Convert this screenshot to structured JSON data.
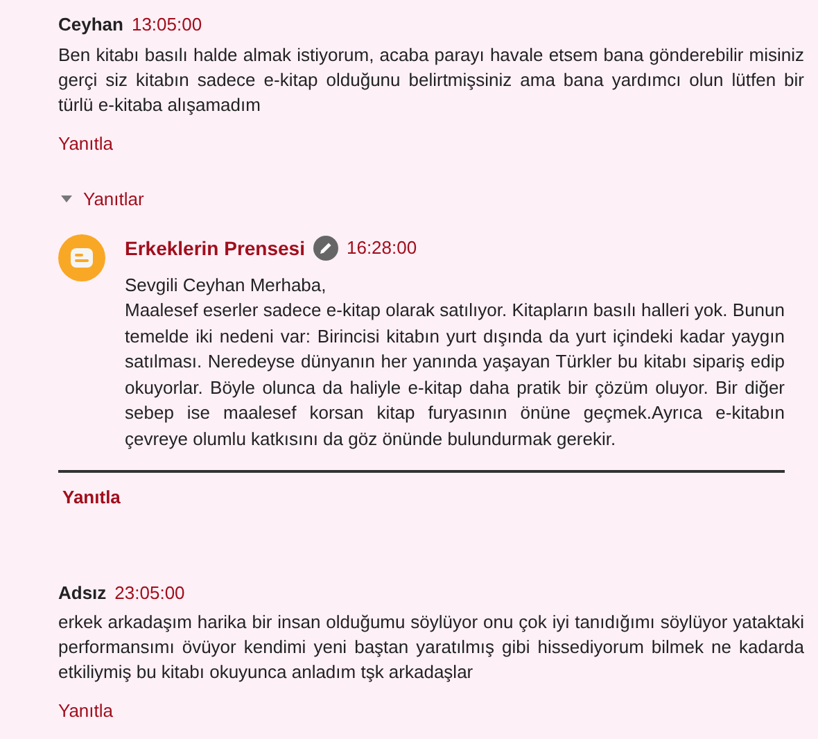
{
  "comments": [
    {
      "author": "Ceyhan",
      "author_is_owner": false,
      "time": "13:05:00",
      "body": "Ben kitabı basılı halde almak istiyorum, acaba parayı havale etsem bana gönderebilir misiniz gerçi siz kitabın sadece e-kitap olduğunu belirtmişsiniz ama bana yardımcı olun lütfen bir türlü e-kitaba alışamadım",
      "reply_link": "Yanıtla",
      "replies_toggle": {
        "label": "Yanıtlar",
        "expanded": true
      },
      "replies": [
        {
          "author": "Erkeklerin Prensesi",
          "author_is_owner": true,
          "time": "16:28:00",
          "body": "Sevgili Ceyhan Merhaba,\nMaalesef eserler sadece e-kitap olarak satılıyor. Kitapların basılı halleri yok. Bunun temelde iki nedeni var: Birincisi kitabın yurt dışında da yurt içindeki kadar yaygın satılması. Neredeyse dünyanın her yanında yaşayan Türkler bu kitabı sipariş edip okuyorlar. Böyle olunca da haliyle e-kitap daha pratik bir çözüm oluyor. Bir diğer sebep ise maalesef korsan kitap furyasının önüne geçmek.Ayrıca e-kitabın çevreye olumlu katkısını da göz önünde bulundurmak gerekir."
        }
      ],
      "thread_reply_link": "Yanıtla"
    },
    {
      "author": "Adsız",
      "author_is_owner": false,
      "time": "23:05:00",
      "body": "erkek arkadaşım harika bir insan olduğumu söylüyor onu çok iyi tanıdığımı söylüyor yataktaki performansımı övüyor kendimi yeni baştan yaratılmış gibi hissediyorum bilmek ne kadarda etkiliymiş bu kitabı okuyunca anladım tşk arkadaşlar",
      "reply_link": "Yanıtla"
    }
  ]
}
